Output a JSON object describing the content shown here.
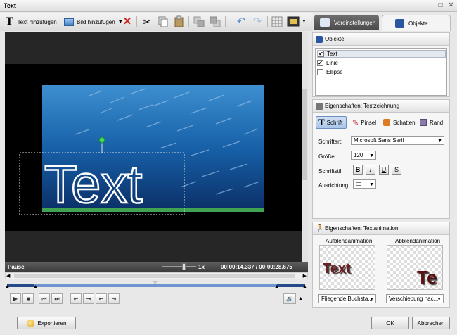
{
  "window": {
    "title": "Text"
  },
  "toolbar": {
    "add_text_label": "Text hinzufügen",
    "add_image_label": "Bild hinzufügen"
  },
  "tabs": [
    {
      "label": "Voreinstellungen"
    },
    {
      "label": "Objekte"
    }
  ],
  "preview": {
    "overlay_text": "Text",
    "status": "Pause",
    "speed": "1x",
    "time": "00:00:14.337 / 00:00:28.675"
  },
  "objects_panel": {
    "title": "Objekte",
    "items": [
      {
        "label": "Text",
        "checked": true
      },
      {
        "label": "Linie",
        "checked": true
      },
      {
        "label": "Ellipse",
        "checked": false
      }
    ]
  },
  "props_panel": {
    "title": "Eigenschaften: Textzeichnung",
    "tabs": [
      "Schrift",
      "Pinsel",
      "Schatten",
      "Rand"
    ],
    "font_label": "Schriftart:",
    "font_value": "Microsoft Sans Serif",
    "size_label": "Größe:",
    "size_value": "120",
    "style_label": "Schriftstil:",
    "style_buttons": [
      "B",
      "I",
      "U",
      "S"
    ],
    "align_label": "Ausrichtung:"
  },
  "anim_panel": {
    "title": "Eigenschaften: Textanimation",
    "in_label": "Aufblendanimation",
    "out_label": "Abblendanimation",
    "in_preview_text": "Text",
    "out_preview_text": "Te",
    "in_value": "Fliegende Buchsta...",
    "out_value": "Verschiebung nac..."
  },
  "footer": {
    "export_label": "Exportieren",
    "ok_label": "OK",
    "cancel_label": "Abbrechen"
  }
}
